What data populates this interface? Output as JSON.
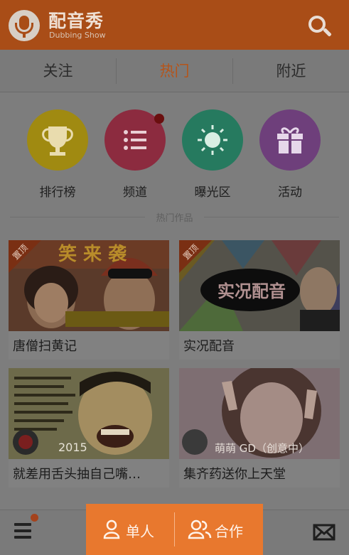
{
  "header": {
    "title": "配音秀",
    "subtitle": "Dubbing Show",
    "search_icon": "search-icon"
  },
  "tabs": [
    {
      "label": "关注",
      "active": false
    },
    {
      "label": "热门",
      "active": true
    },
    {
      "label": "附近",
      "active": false
    }
  ],
  "categories": [
    {
      "label": "排行榜",
      "icon": "trophy-icon",
      "color": "#a08a11"
    },
    {
      "label": "频道",
      "icon": "list-icon",
      "color": "#8c2b3f",
      "badge": true
    },
    {
      "label": "曝光区",
      "icon": "sun-icon",
      "color": "#267a5f"
    },
    {
      "label": "活动",
      "icon": "gift-icon",
      "color": "#6e3f7b"
    }
  ],
  "section_title": "热门作品",
  "cards": [
    {
      "caption": "唐僧扫黄记",
      "tag": "置顶",
      "thumb_text": "唐僧扫黄记"
    },
    {
      "caption": "实况配音",
      "tag": "置顶",
      "thumb_text": "实况配音"
    },
    {
      "caption": "就差用舌头抽自己嘴…",
      "thumb_text": "2015"
    },
    {
      "caption": "集齐药送你上天堂",
      "thumb_text": "萌萌 GD（创意中）"
    }
  ],
  "bottom": {
    "single_label": "单人",
    "coop_label": "合作",
    "menu_icon": "menu-icon",
    "mail_icon": "mail-icon"
  },
  "colors": {
    "header": "#a94d17",
    "accent": "#e8782e",
    "overlay_bg": "#7d7d7d"
  }
}
